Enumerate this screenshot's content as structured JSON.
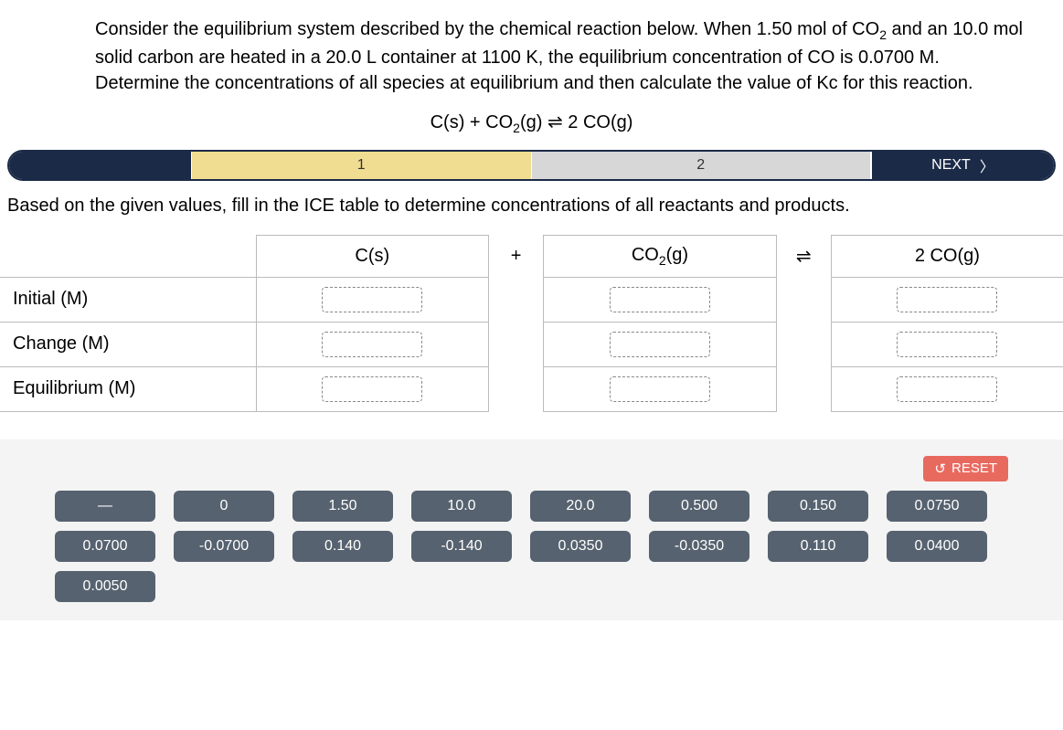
{
  "prompt_html": "Consider the equilibrium system described by the chemical reaction below. When 1.50 mol of CO<sub>2</sub> and an 10.0 mol solid carbon are heated in a 20.0 L container at 1100 K, the equilibrium concentration of CO is 0.0700 M. Determine the concentrations of all species at equilibrium and then calculate the value of Kc for this reaction.",
  "equation_html": "C(s) + CO<sub>2</sub>(g) ⇌ 2 CO(g)",
  "progress": {
    "steps": [
      "1",
      "2"
    ],
    "active_index": 0,
    "next_label": "NEXT"
  },
  "instruction": "Based on the given values, fill in the ICE table to determine concentrations of all reactants and products.",
  "table": {
    "col_headers_html": [
      "C(s)",
      "+",
      "CO<sub>2</sub>(g)",
      "⇌",
      "2 CO(g)"
    ],
    "row_labels": [
      "Initial (M)",
      "Change (M)",
      "Equilibrium (M)"
    ]
  },
  "reset_label": "RESET",
  "chips": [
    [
      "—",
      "0",
      "1.50",
      "10.0",
      "20.0",
      "0.500",
      "0.150",
      "0.0750"
    ],
    [
      "0.0700",
      "-0.0700",
      "0.140",
      "-0.140",
      "0.0350",
      "-0.0350",
      "0.110",
      "0.0400"
    ],
    [
      "0.0050"
    ]
  ]
}
